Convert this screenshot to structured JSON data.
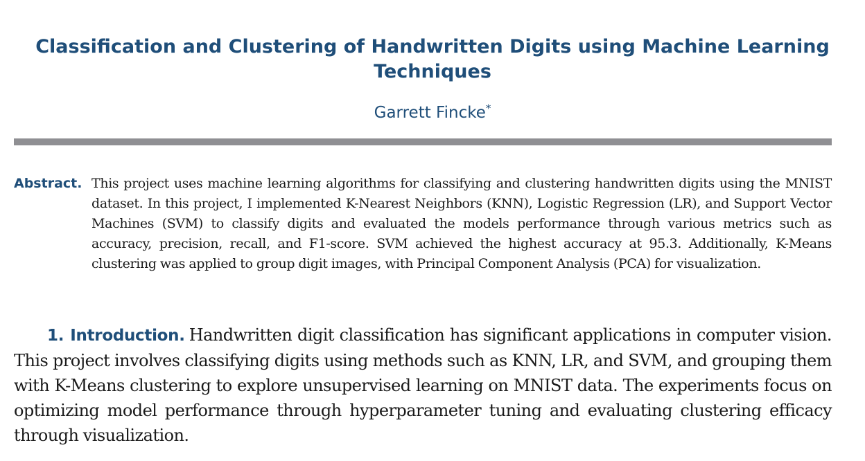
{
  "paper": {
    "title": "Classification and Clustering of Handwritten Digits using Machine Learning Techniques",
    "author": "Garrett  Fincke",
    "author_mark": "*"
  },
  "abstract": {
    "label": "Abstract.",
    "text": "This project uses machine learning algorithms for classifying and clustering handwritten digits using the MNIST dataset. In this project, I implemented K-Nearest Neighbors (KNN), Logistic Regression (LR), and Support Vector Machines (SVM) to classify digits and evaluated the models performance through various metrics such as accuracy, precision, recall, and F1-score. SVM achieved the highest accuracy at 95.3. Additionally, K-Means clustering was applied to group digit images, with Principal Component Analysis (PCA) for visualization."
  },
  "sections": [
    {
      "heading": "1. Introduction.",
      "text": "Handwritten digit classification has significant applications in computer vision. This project involves classifying digits using methods such as KNN, LR, and SVM, and grouping them with K-Means clustering to explore unsupervised learning on MNIST data. The experiments focus on optimizing model performance through hyperparameter tuning and evaluating clustering efficacy through visualization."
    }
  ],
  "colors": {
    "heading_blue": "#1f4e79",
    "rule_gray": "#8f8f93",
    "body_text": "#1a1a1a"
  }
}
